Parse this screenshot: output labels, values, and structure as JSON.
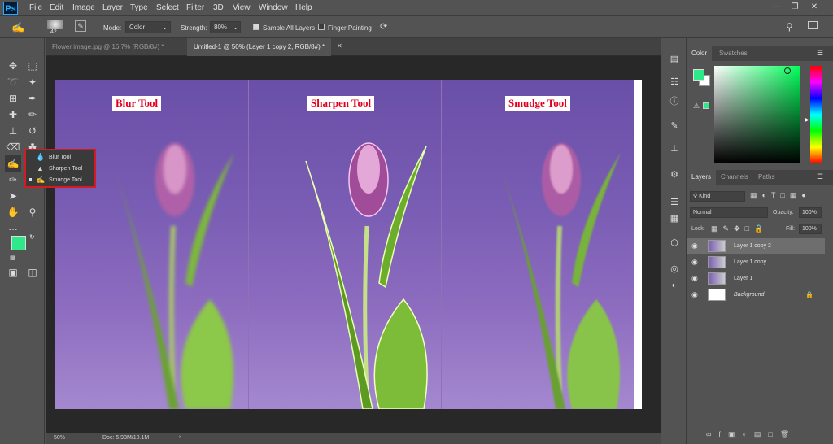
{
  "menubar": {
    "logo": "Ps",
    "items": [
      "File",
      "Edit",
      "Image",
      "Layer",
      "Type",
      "Select",
      "Filter",
      "3D",
      "View",
      "Window",
      "Help"
    ],
    "window_controls": [
      "minimize",
      "restore",
      "close"
    ]
  },
  "options": {
    "brush_size": "42",
    "mode_label": "Mode:",
    "mode_value": "Color",
    "strength_label": "Strength:",
    "strength_value": "80%",
    "sample_all_layers": "Sample All Layers",
    "finger_painting": "Finger Painting"
  },
  "tabs": [
    {
      "label": "Flower image.jpg @ 16.7% (RGB/8#) *",
      "active": false
    },
    {
      "label": "Untitled-1 @ 50% (Layer 1 copy 2, RGB/8#) *",
      "active": true
    }
  ],
  "canvas": {
    "captions": [
      "Blur Tool",
      "Sharpen Tool",
      "Smudge Tool"
    ]
  },
  "flyout": {
    "items": [
      "Blur Tool",
      "Sharpen Tool",
      "Smudge Tool"
    ]
  },
  "status": {
    "zoom": "50%",
    "doc": "Doc: 5.93M/10.1M"
  },
  "color_panel": {
    "tabs": [
      "Color",
      "Swatches"
    ],
    "foreground": "#2ee88a",
    "background": "#ffffff"
  },
  "layers_panel": {
    "tabs": [
      "Layers",
      "Channels",
      "Paths"
    ],
    "kind": "Kind",
    "blend_mode": "Normal",
    "opacity_label": "Opacity:",
    "opacity_value": "100%",
    "lock_label": "Lock:",
    "fill_label": "Fill:",
    "fill_value": "100%",
    "layers": [
      {
        "name": "Layer 1 copy 2",
        "selected": true
      },
      {
        "name": "Layer 1 copy",
        "selected": false
      },
      {
        "name": "Layer 1",
        "selected": false
      },
      {
        "name": "Background",
        "selected": false
      }
    ]
  },
  "colors": {
    "accent": "#31a8ff",
    "highlight_box": "#d41b24",
    "caption_text": "#e0001e"
  }
}
